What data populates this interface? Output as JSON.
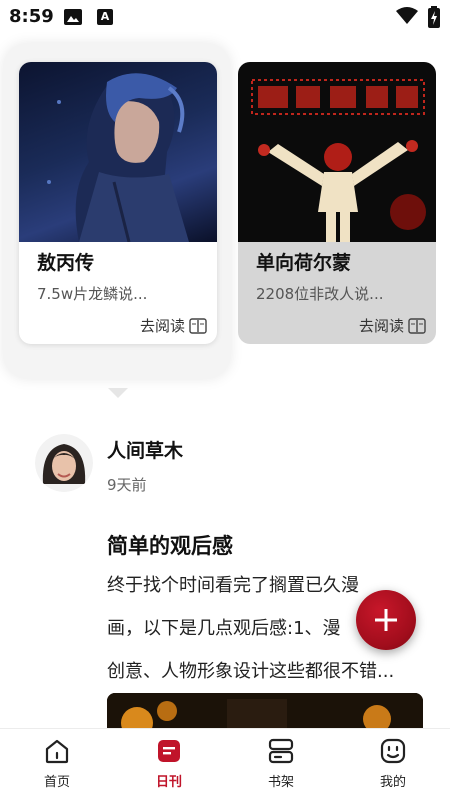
{
  "status_bar": {
    "time": "8:59",
    "icons": [
      "image-icon",
      "a-icon",
      "wifi-icon",
      "battery-icon"
    ],
    "a_glyph": "A"
  },
  "carousel": {
    "cards": [
      {
        "title": "敖丙传",
        "subtitle": "7.5w片龙鳞说...",
        "action": "去阅读"
      },
      {
        "title": "单向荷尔蒙",
        "subtitle": "2208位非改人说...",
        "action": "去阅读"
      }
    ]
  },
  "post": {
    "author": "人间草木",
    "time": "9天前",
    "title": "简单的观后感",
    "body_lines": [
      "终于找个时间看完了搁置已久漫",
      "画，以下是几点观后感:1、漫",
      "创意、人物形象设计这些都很不错..."
    ]
  },
  "fab": {
    "icon": "plus-icon"
  },
  "nav": {
    "items": [
      {
        "label": "首页",
        "icon": "home-icon",
        "active": false
      },
      {
        "label": "日刊",
        "icon": "daily-icon",
        "active": true
      },
      {
        "label": "书架",
        "icon": "bookshelf-icon",
        "active": false
      },
      {
        "label": "我的",
        "icon": "profile-icon",
        "active": false
      }
    ]
  },
  "colors": {
    "accent": "#c0142a",
    "fab": "#a10d1c"
  }
}
